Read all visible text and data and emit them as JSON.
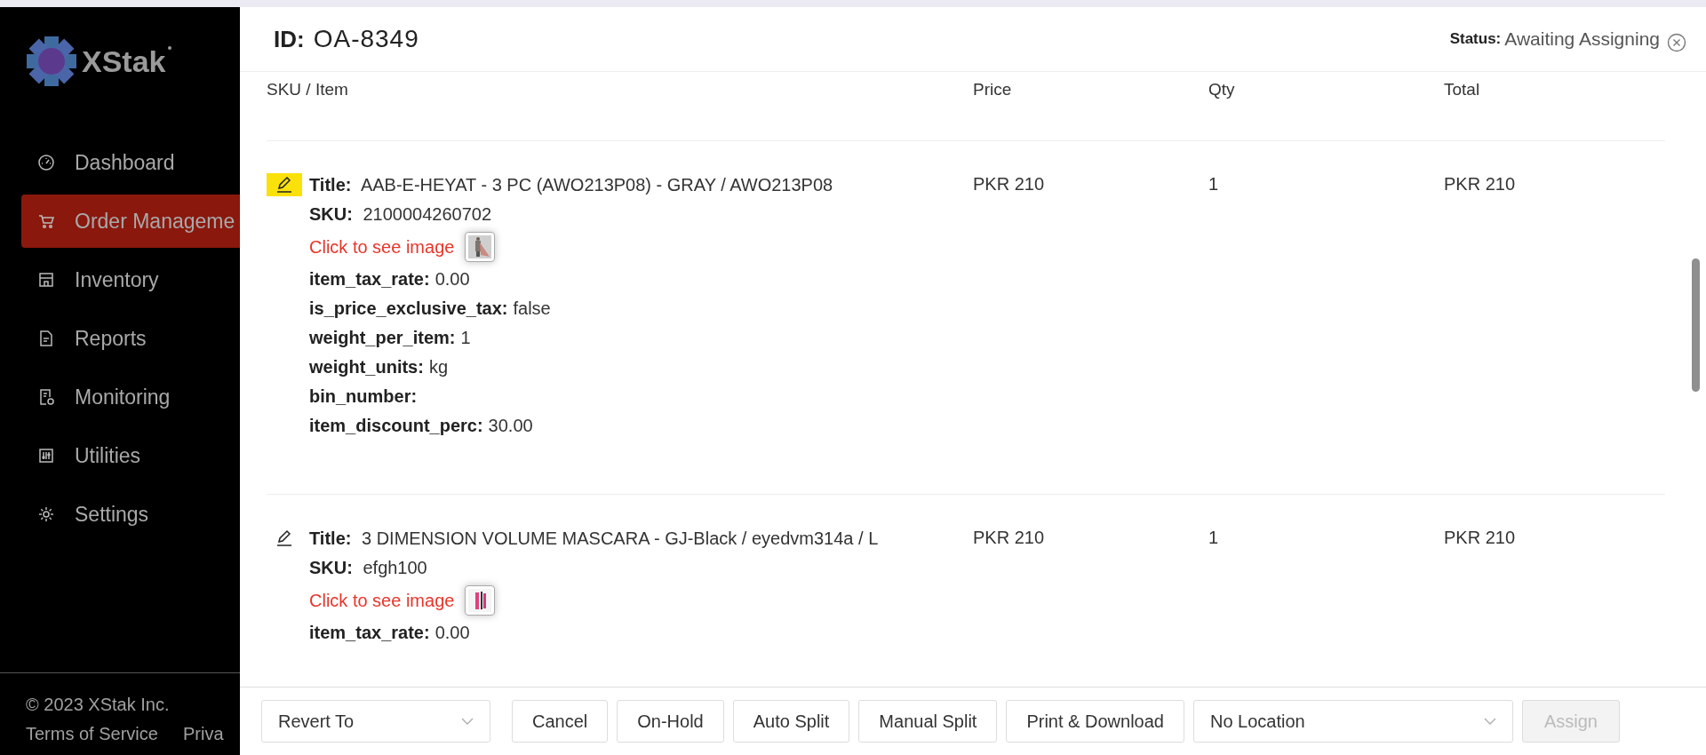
{
  "sidebar": {
    "logo": "XStak",
    "items": [
      {
        "label": "Dashboard",
        "selected": false
      },
      {
        "label": "Order Manageme",
        "selected": true
      },
      {
        "label": "Inventory",
        "selected": false
      },
      {
        "label": "Reports",
        "selected": false
      },
      {
        "label": "Monitoring",
        "selected": false
      },
      {
        "label": "Utilities",
        "selected": false
      },
      {
        "label": "Settings",
        "selected": false
      }
    ],
    "copyright": "© 2023 XStak Inc.",
    "links": [
      "Terms of Service",
      "Priva"
    ]
  },
  "order": {
    "id_label": "ID:",
    "id": "OA-8349",
    "status_label": "Status:",
    "status": "Awaiting Assigning"
  },
  "table": {
    "columns": [
      "SKU / Item",
      "Price",
      "Qty",
      "Total"
    ],
    "rows": [
      {
        "highlighted": true,
        "title_label": "Title:",
        "title": "AAB-E-HEYAT - 3 PC (AWO213P08) - GRAY / AWO213P08",
        "sku_label": "SKU:",
        "sku": "2100004260702",
        "image_link": "Click to see image",
        "price": "PKR 210",
        "qty": "1",
        "total": "PKR 210",
        "fields": [
          {
            "label": "item_tax_rate:",
            "value": "0.00"
          },
          {
            "label": "is_price_exclusive_tax:",
            "value": "false"
          },
          {
            "label": "weight_per_item:",
            "value": "1"
          },
          {
            "label": "weight_units:",
            "value": "kg"
          },
          {
            "label": "bin_number:"
          },
          {
            "label": "item_discount_perc:",
            "value": "30.00"
          }
        ]
      },
      {
        "highlighted": false,
        "title_label": "Title:",
        "title": "3 DIMENSION VOLUME MASCARA - GJ-Black / eyedvm314a / L",
        "sku_label": "SKU:",
        "sku": "efgh100",
        "image_link": "Click to see image",
        "price": "PKR 210",
        "qty": "1",
        "total": "PKR 210",
        "fields": [
          {
            "label": "item_tax_rate:",
            "value": "0.00"
          }
        ]
      }
    ]
  },
  "footer": {
    "revert": {
      "placeholder": "Revert To"
    },
    "buttons": [
      {
        "label": "Cancel",
        "disabled": false
      },
      {
        "label": "On-Hold",
        "disabled": false
      },
      {
        "label": "Auto Split",
        "disabled": false
      },
      {
        "label": "Manual Split",
        "disabled": false
      },
      {
        "label": "Print & Download",
        "disabled": false
      }
    ],
    "location": {
      "value": "No Location"
    },
    "assign": {
      "label": "Assign",
      "disabled": true
    }
  }
}
